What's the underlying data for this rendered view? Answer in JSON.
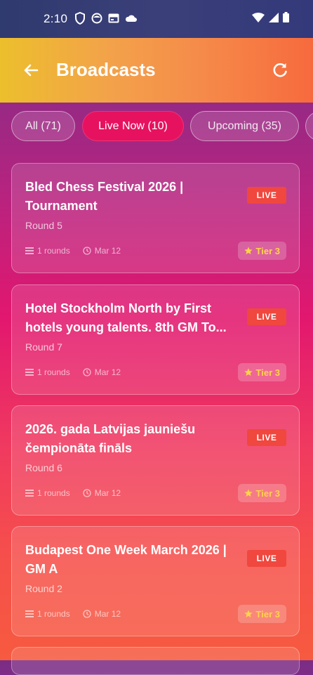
{
  "status_bar": {
    "time": "2:10"
  },
  "app_bar": {
    "title": "Broadcasts",
    "back_icon": "arrow-left-icon",
    "refresh_icon": "refresh-icon"
  },
  "filters": [
    {
      "label": "All (71)",
      "active": false
    },
    {
      "label": "Live Now (10)",
      "active": true
    },
    {
      "label": "Upcoming (35)",
      "active": false
    }
  ],
  "broadcasts": [
    {
      "title": "Bled Chess Festival 2026 | Tournament",
      "badge": "LIVE",
      "round": "Round 5",
      "rounds": "1 rounds",
      "date": "Mar 12",
      "tier": "Tier 3"
    },
    {
      "title": "Hotel Stockholm North by First hotels young talents. 8th GM To...",
      "badge": "LIVE",
      "round": "Round 7",
      "rounds": "1 rounds",
      "date": "Mar 12",
      "tier": "Tier 3"
    },
    {
      "title": "2026. gada Latvijas jauniešu čempionāta fināls",
      "badge": "LIVE",
      "round": "Round 6",
      "rounds": "1 rounds",
      "date": "Mar 12",
      "tier": "Tier 3"
    },
    {
      "title": "Budapest One Week March 2026 | GM A",
      "badge": "LIVE",
      "round": "Round 2",
      "rounds": "1 rounds",
      "date": "Mar 12",
      "tier": "Tier 3"
    }
  ],
  "colors": {
    "live": "#f0473e",
    "chip_active": "#e7125f",
    "tier_text": "#ffd34a"
  }
}
